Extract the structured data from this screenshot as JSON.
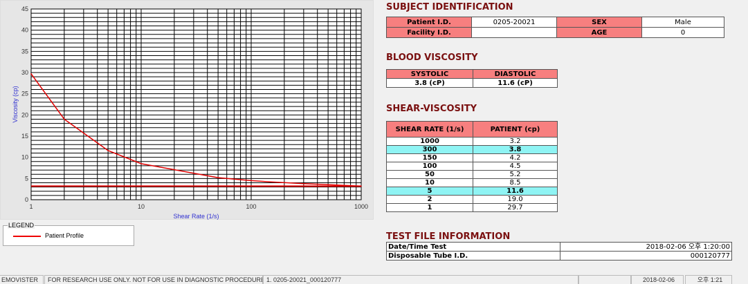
{
  "chart_data": {
    "type": "line",
    "xlabel": "Shear Rate (1/s)",
    "ylabel": "Viscosity (cp)",
    "xscale": "log",
    "xlim": [
      1,
      1000
    ],
    "ylim": [
      0,
      45
    ],
    "xticks": [
      "1",
      "10",
      "100",
      "1000"
    ],
    "yticks": [
      "0",
      "5",
      "10",
      "15",
      "20",
      "25",
      "30",
      "35",
      "40",
      "45"
    ],
    "grid": true,
    "series": [
      {
        "name": "Patient Profile",
        "color": "#e00000",
        "x": [
          1,
          2,
          5,
          10,
          50,
          100,
          150,
          300,
          1000
        ],
        "y": [
          29.7,
          19.0,
          11.6,
          8.5,
          5.2,
          4.5,
          4.2,
          3.8,
          3.2
        ]
      }
    ],
    "reference_line": {
      "y": 3.2,
      "color": "#e00000"
    }
  },
  "legend": {
    "title": "LEGEND",
    "items": [
      "Patient Profile"
    ]
  },
  "subject": {
    "title": "SUBJECT IDENTIFICATION",
    "patient_id_label": "Patient I.D.",
    "patient_id": "0205-20021",
    "sex_label": "SEX",
    "sex": "Male",
    "facility_label": "Facility I.D.",
    "facility": "",
    "age_label": "AGE",
    "age": "0"
  },
  "blood": {
    "title": "BLOOD VISCOSITY",
    "systolic_label": "SYSTOLIC",
    "diastolic_label": "DIASTOLIC",
    "systolic": "3.8 (cP)",
    "diastolic": "11.6 (cP)"
  },
  "shear": {
    "title": "SHEAR-VISCOSITY",
    "col1": "SHEAR RATE (1/s)",
    "col2": "PATIENT (cp)",
    "rows": [
      [
        "1000",
        "3.2"
      ],
      [
        "300",
        "3.8"
      ],
      [
        "150",
        "4.2"
      ],
      [
        "100",
        "4.5"
      ],
      [
        "50",
        "5.2"
      ],
      [
        "10",
        "8.5"
      ],
      [
        "5",
        "11.6"
      ],
      [
        "2",
        "19.0"
      ],
      [
        "1",
        "29.7"
      ]
    ],
    "highlight": [
      "300",
      "5"
    ]
  },
  "testfile": {
    "title": "TEST FILE INFORMATION",
    "datetime_label": "Date/Time Test",
    "datetime": "2018-02-06  오후 1:20:00",
    "tube_label": "Disposable Tube I.D.",
    "tube": "000120777"
  },
  "status": {
    "app": "EMOVISTER",
    "notice": "FOR RESEARCH USE ONLY. NOT FOR USE IN DIAGNOSTIC PROCEDURES",
    "file": "1. 0205-20021_000120777",
    "date": "2018-02-06",
    "time": "오후 1:21"
  },
  "colors": {
    "header_cell": "#f77f7f",
    "highlight_row": "#8ff4f4",
    "title": "#7a1010",
    "curve": "#e00000"
  }
}
